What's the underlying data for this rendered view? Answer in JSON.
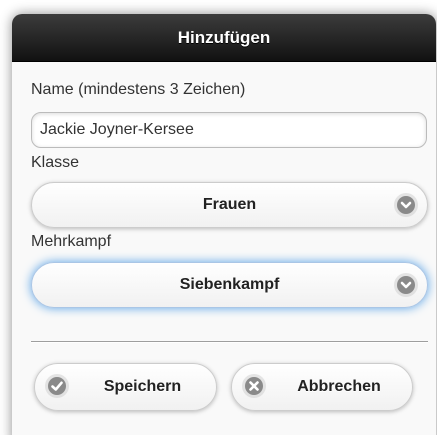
{
  "dialog": {
    "title": "Hinzufügen"
  },
  "form": {
    "name_label": "Name (mindestens 3 Zeichen)",
    "name_value": "Jackie Joyner-Kersee",
    "class_label": "Klasse",
    "class_value": "Frauen",
    "event_label": "Mehrkampf",
    "event_value": "Siebenkampf"
  },
  "buttons": {
    "save_label": "Speichern",
    "cancel_label": "Abbrechen"
  },
  "icons": {
    "select_arrow": "chevron-down-icon",
    "save": "check-icon",
    "cancel": "close-icon"
  },
  "colors": {
    "header_background": "#1e1e1e",
    "focus_glow": "#5aa3e6",
    "icon_disc": "#8a8a8a"
  }
}
